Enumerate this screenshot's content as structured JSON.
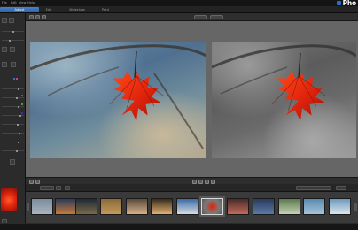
{
  "menubar": {
    "items": [
      "File",
      "Edit",
      "View",
      "Help"
    ],
    "app_logo_text": "Pho"
  },
  "mode_tabs": {
    "items": [
      "Adjust",
      "Edit",
      "Slideshow",
      "Print"
    ],
    "active_index": 0
  },
  "colors": {
    "accent": "#2d5e9c",
    "workspace": "#666666",
    "filmstrip": "#3a3a3a",
    "leaf_red": "#e0240c"
  },
  "workspace": {
    "toolbar_pills": [
      "",
      ""
    ],
    "before_label": "",
    "after_label": ""
  },
  "filmstrip": {
    "selected_index": 7,
    "thumb_count": 13
  }
}
